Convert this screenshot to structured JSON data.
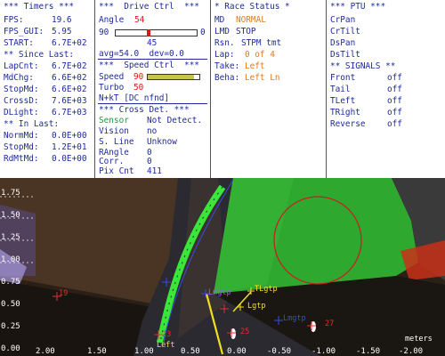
{
  "timers": {
    "header": "*** Timers ***",
    "fps_label": "FPS:",
    "fps": "19.6",
    "fps_gui_label": "FPS_GUI:",
    "fps_gui": "5.95",
    "start_label": "START:",
    "start": "6.7E+02",
    "since_header": "** Since Last:",
    "lapcnt_label": "LapCnt:",
    "lapcnt": "6.7E+02",
    "mdchg_label": "MdChg:",
    "mdchg": "6.6E+02",
    "stopmd_label": "StopMd:",
    "stopmd": "6.6E+02",
    "crossd_label": "CrossD:",
    "crossd": "7.6E+03",
    "dlight_label": "DLight:",
    "dlight": "6.7E+03",
    "in_header": "** In Last:",
    "normmd_label": "NormMd:",
    "normmd": "0.0E+00",
    "stopmd2_label": "StopMd:",
    "stopmd2": "1.2E+01",
    "rdmtmd_label": "RdMtMd:",
    "rdmtmd": "0.0E+00"
  },
  "drive": {
    "header": "***  Drive Ctrl  ***",
    "angle_label": "Angle",
    "angle": "54",
    "slider_min": "90",
    "slider_max": "0",
    "slider_value": 54,
    "slider_center": "45",
    "avg": "avg=54.0  dev=0.0",
    "speed_header": "***  Speed Ctrl  ***",
    "speed_label": "Speed",
    "speed": "90",
    "speed_fraction": 0.9,
    "turbo_label": "Turbo",
    "turbo": "50",
    "nkt": "N+kT [DC nfnd]",
    "cross_header": "*** Cross Det. ***",
    "sensor_label": "Sensor",
    "sensor": "Not Detect.",
    "vision_label": "Vision",
    "vision": "no",
    "sline_label": "S. Line",
    "sline": "Unknow",
    "rangle_label": "RAngle",
    "rangle": "0",
    "corr_label": "Corr.",
    "corr": "0",
    "pixcnt_label": "Pix Cnt",
    "pixcnt": "411"
  },
  "race": {
    "header": "* Race Status *",
    "md_label": "MD",
    "md": "NORMAL",
    "lmd_label": "LMD",
    "lmd": "STOP",
    "rsn_label": "Rsn.",
    "rsn": "STPM tmt",
    "lap_label": "Lap:",
    "lap": "0 of 4",
    "take_label": "Take:",
    "take": "Left",
    "beha_label": "Beha:",
    "beha": "Left Ln"
  },
  "ptu": {
    "header": "*** PTU ***",
    "items": [
      "CrPan",
      "CrTilt",
      "DsPan",
      "DsTilt"
    ],
    "signals_header": "** SIGNALS **",
    "signals": [
      {
        "label": "Front",
        "value": "off"
      },
      {
        "label": "Tail",
        "value": "off"
      },
      {
        "label": "TLeft",
        "value": "off"
      },
      {
        "label": "TRight",
        "value": "off"
      },
      {
        "label": "Reverse",
        "value": "off"
      }
    ]
  },
  "camera": {
    "y_ticks": [
      "1.75",
      "1.50",
      "1.25",
      "1.00",
      "0.75",
      "0.50",
      "0.25",
      "0.00"
    ],
    "x_ticks": [
      "2.00",
      "1.50",
      "1.00",
      "0.50",
      "0.00",
      "-0.50",
      "-1.00",
      "-1.50",
      "-2.00"
    ],
    "units": "meters",
    "labels": {
      "a19": "19",
      "a23": "23",
      "a25": "25",
      "a27": "27",
      "left": "Left",
      "lmgtp": "Lmgtp",
      "tlgtp": "TLgtp",
      "lgtp": "Lgtp",
      "lmgtp2": "Lmgtp"
    }
  },
  "colors": {
    "panel_text": "#1e2a9a",
    "accent_red": "#d51a1a",
    "accent_orange": "#e07a1e",
    "accent_green": "#1f9a3a",
    "track_green": "#2ea82e",
    "line_green": "#39e639"
  }
}
